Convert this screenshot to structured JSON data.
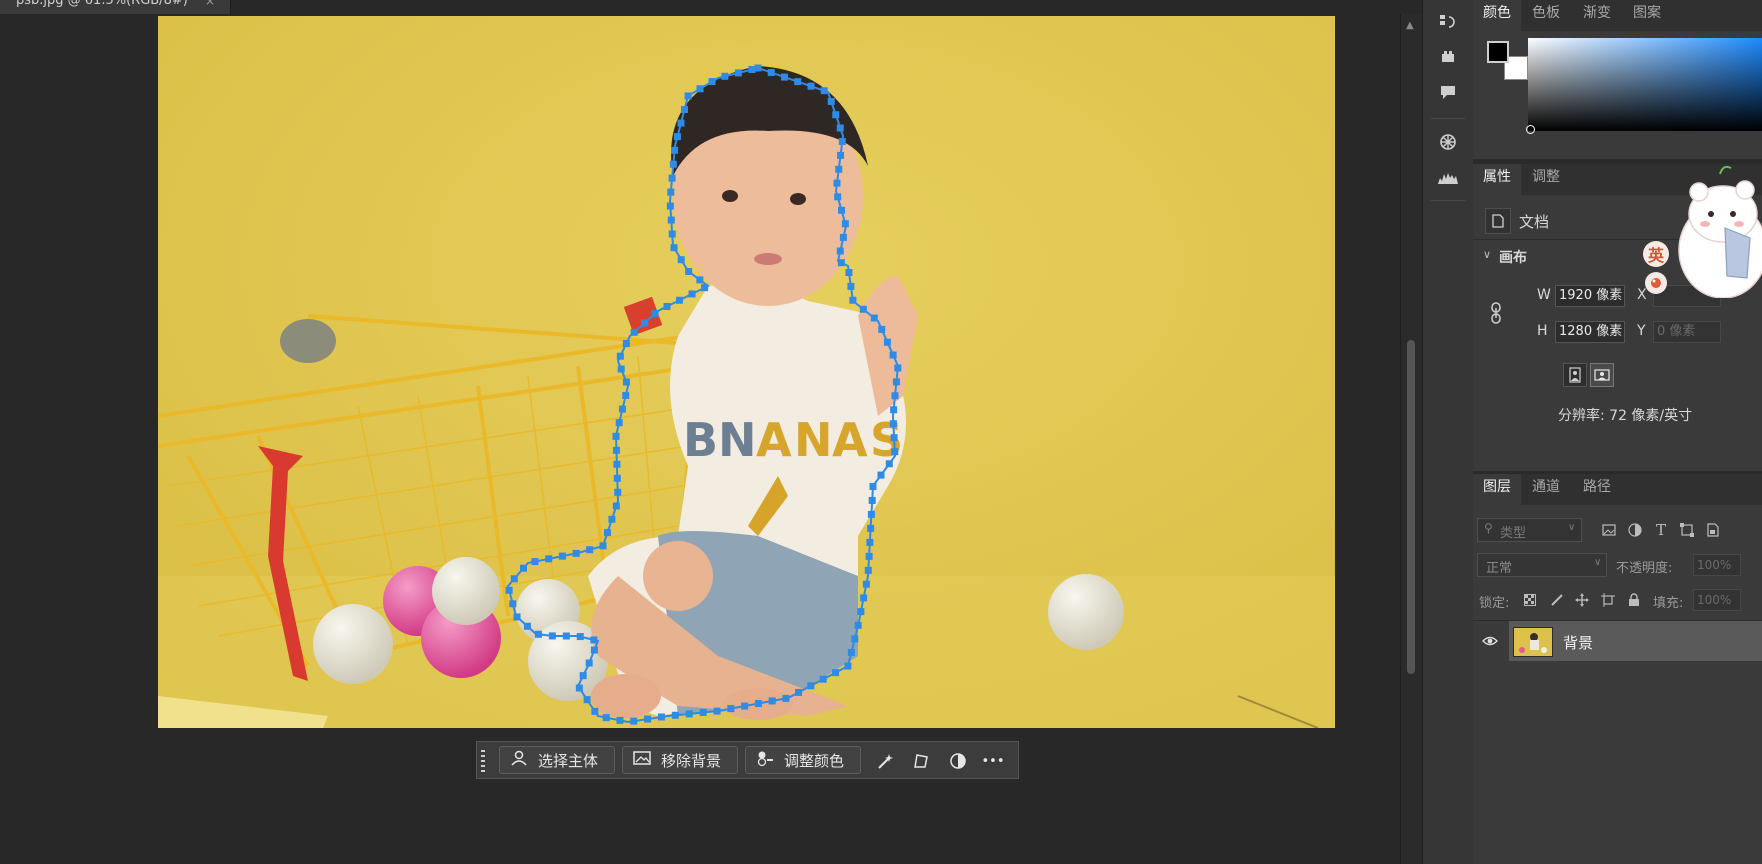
{
  "document_tab": {
    "title": "psb.jpg @ 61.5%(RGB/8#)",
    "close": "×"
  },
  "taskbar": {
    "select_subject": "选择主体",
    "remove_background": "移除背景",
    "adjust_color": "调整颜色",
    "more": "•••"
  },
  "color_panel": {
    "tabs": [
      "颜色",
      "色板",
      "渐变",
      "图案"
    ],
    "foreground_color": "#000000",
    "background_color": "#ffffff",
    "picker_hue": "#1e8bff"
  },
  "properties_panel": {
    "tabs": [
      "属性",
      "调整"
    ],
    "doc_label": "文档",
    "canvas_heading": "画布",
    "w_label": "W",
    "w_value": "1920 像素",
    "h_label": "H",
    "h_value": "1280 像素",
    "x_label": "X",
    "y_label": "Y",
    "y_value": "0 像素",
    "resolution": "分辨率: 72 像素/英寸"
  },
  "layers_panel": {
    "tabs": [
      "图层",
      "通道",
      "路径"
    ],
    "filter_placeholder": "类型",
    "blend_mode": "正常",
    "opacity_label": "不透明度:",
    "opacity_value": "100%",
    "lock_label": "锁定:",
    "fill_label": "填充:",
    "fill_value": "100%",
    "layers": [
      {
        "name": "背景",
        "visible": true
      }
    ]
  },
  "ime_badge": {
    "label": "英"
  }
}
